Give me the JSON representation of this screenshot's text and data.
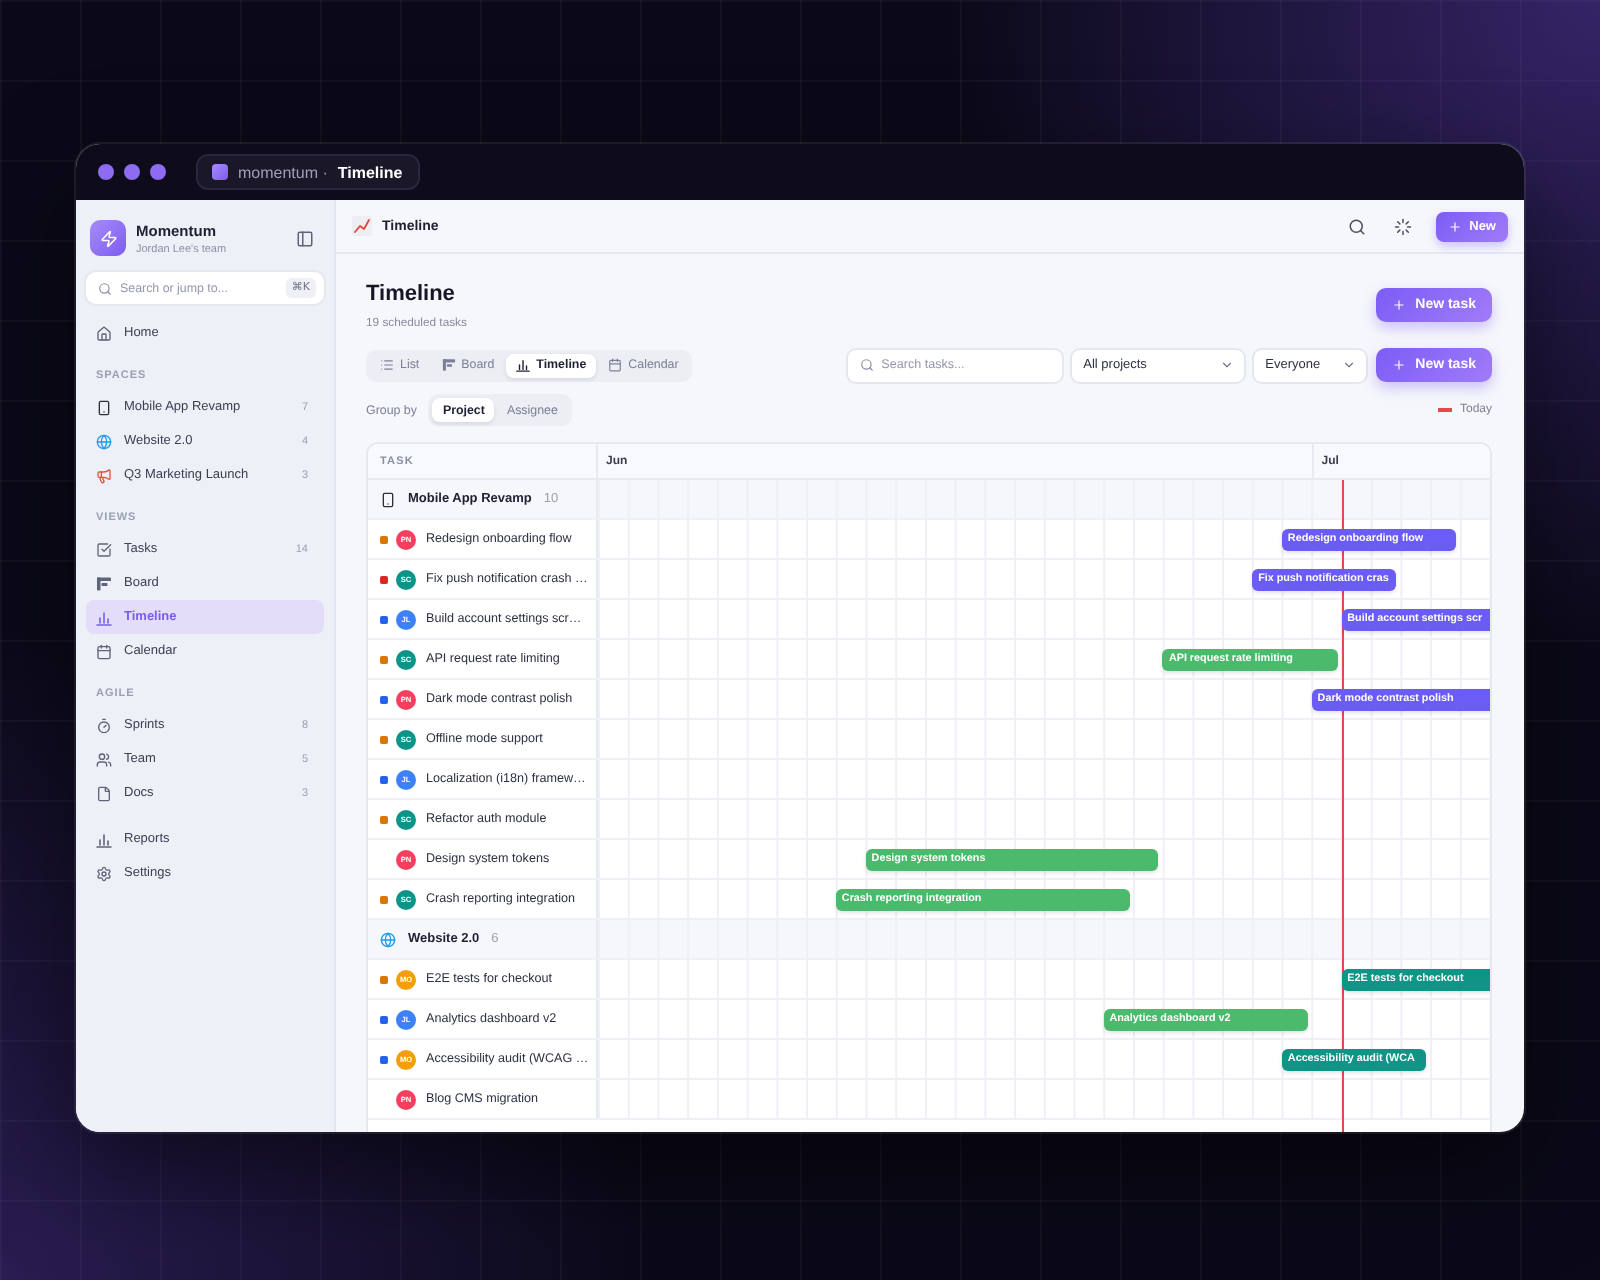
{
  "window": {
    "tab_prefix": "momentum ·",
    "tab_title": "Timeline"
  },
  "sidebar": {
    "brand": "Momentum",
    "team": "Jordan Lee's team",
    "search": {
      "placeholder": "Search or jump to...",
      "shortcut": "⌘K"
    },
    "top_items": [
      {
        "label": "Home",
        "selected": false
      }
    ],
    "sections": [
      {
        "title": "SPACES",
        "items": [
          {
            "label": "Mobile App Revamp",
            "count": "7",
            "selected": false
          },
          {
            "label": "Website 2.0",
            "count": "4",
            "selected": false
          },
          {
            "label": "Q3 Marketing Launch",
            "count": "3",
            "selected": false
          }
        ]
      },
      {
        "title": "VIEWS",
        "items": [
          {
            "label": "Tasks",
            "count": "14",
            "selected": false
          },
          {
            "label": "Board",
            "selected": false
          },
          {
            "label": "Timeline",
            "selected": true
          },
          {
            "label": "Calendar",
            "selected": false
          }
        ]
      },
      {
        "title": "AGILE",
        "items": [
          {
            "label": "Sprints",
            "count": "8",
            "selected": false
          },
          {
            "label": "Team",
            "count": "5",
            "selected": false
          },
          {
            "label": "Docs",
            "count": "3",
            "selected": false
          }
        ]
      }
    ],
    "bottom_items": [
      {
        "label": "Reports",
        "selected": false
      },
      {
        "label": "Settings",
        "selected": false
      }
    ]
  },
  "topbar": {
    "title": "Timeline",
    "new_button": "New"
  },
  "header": {
    "title": "Timeline",
    "subtitle": "19 scheduled tasks",
    "new_task_button": "New task"
  },
  "toolbar": {
    "views": [
      {
        "label": "List",
        "selected": false
      },
      {
        "label": "Board",
        "selected": false
      },
      {
        "label": "Timeline",
        "selected": true
      },
      {
        "label": "Calendar",
        "selected": false
      }
    ],
    "search": {
      "placeholder": "Search tasks..."
    },
    "project_filter": "All projects",
    "assignee_filter": "Everyone",
    "new_task_button": "New task"
  },
  "group_by": {
    "label": "Group by",
    "options": [
      {
        "label": "Project",
        "selected": true
      },
      {
        "label": "Assignee",
        "selected": false
      }
    ],
    "today_legend": "Today"
  },
  "timeline": {
    "task_column": "TASK",
    "months": [
      {
        "label": "Jun"
      },
      {
        "label": "Jul"
      }
    ],
    "groups": [
      {
        "name": "Mobile App Revamp",
        "count": "10",
        "tasks": [
          {
            "name": "Redesign onboarding flow",
            "priority": {
              "color": "#d97706"
            },
            "assignee": {
              "initials": "PN",
              "color": "#f43f5e"
            },
            "bar": {
              "label": "Redesign onboarding flow",
              "color": "#6b5cf6"
            }
          },
          {
            "name": "Fix push notification crash …",
            "priority": {
              "color": "#dc2626"
            },
            "assignee": {
              "initials": "SC",
              "color": "#0d9488"
            },
            "bar": {
              "label": "Fix push notification cras",
              "color": "#6b5cf6"
            }
          },
          {
            "name": "Build account settings scr…",
            "priority": {
              "color": "#2563eb"
            },
            "assignee": {
              "initials": "JL",
              "color": "#3b82f6"
            },
            "bar": {
              "label": "Build account settings scr",
              "color": "#6b5cf6"
            }
          },
          {
            "name": "API request rate limiting",
            "priority": {
              "color": "#d97706"
            },
            "assignee": {
              "initials": "SC",
              "color": "#0d9488"
            },
            "bar": {
              "label": "API request rate limiting",
              "color": "#4cba6d"
            }
          },
          {
            "name": "Dark mode contrast polish",
            "priority": {
              "color": "#2563eb"
            },
            "assignee": {
              "initials": "PN",
              "color": "#f43f5e"
            },
            "bar": {
              "label": "Dark mode contrast polish",
              "color": "#6b5cf6"
            }
          },
          {
            "name": "Offline mode support",
            "priority": {
              "color": "#d97706"
            },
            "assignee": {
              "initials": "SC",
              "color": "#0d9488"
            }
          },
          {
            "name": "Localization (i18n) framew…",
            "priority": {
              "color": "#2563eb"
            },
            "assignee": {
              "initials": "JL",
              "color": "#3b82f6"
            }
          },
          {
            "name": "Refactor auth module",
            "priority": {
              "color": "#d97706"
            },
            "assignee": {
              "initials": "SC",
              "color": "#0d9488"
            }
          },
          {
            "name": "Design system tokens",
            "assignee": {
              "initials": "PN",
              "color": "#f43f5e"
            },
            "bar": {
              "label": "Design system tokens",
              "color": "#4cba6d"
            }
          },
          {
            "name": "Crash reporting integration",
            "priority": {
              "color": "#d97706"
            },
            "assignee": {
              "initials": "SC",
              "color": "#0d9488"
            },
            "bar": {
              "label": "Crash reporting integration",
              "color": "#4cba6d"
            }
          }
        ]
      },
      {
        "name": "Website 2.0",
        "count": "6",
        "tasks": [
          {
            "name": "E2E tests for checkout",
            "priority": {
              "color": "#d97706"
            },
            "assignee": {
              "initials": "MO",
              "color": "#f59e0b"
            },
            "bar": {
              "label": "E2E tests for checkout",
              "color": "#0f9486"
            }
          },
          {
            "name": "Analytics dashboard v2",
            "priority": {
              "color": "#2563eb"
            },
            "assignee": {
              "initials": "JL",
              "color": "#3b82f6"
            },
            "bar": {
              "label": "Analytics dashboard v2",
              "color": "#4cba6d"
            }
          },
          {
            "name": "Accessibility audit (WCAG …",
            "priority": {
              "color": "#2563eb"
            },
            "assignee": {
              "initials": "MO",
              "color": "#f59e0b"
            },
            "bar": {
              "label": "Accessibility audit (WCA",
              "color": "#0f9486"
            }
          },
          {
            "name": "Blog CMS migration",
            "assignee": {
              "initials": "PN",
              "color": "#f43f5e"
            }
          }
        ]
      }
    ]
  }
}
